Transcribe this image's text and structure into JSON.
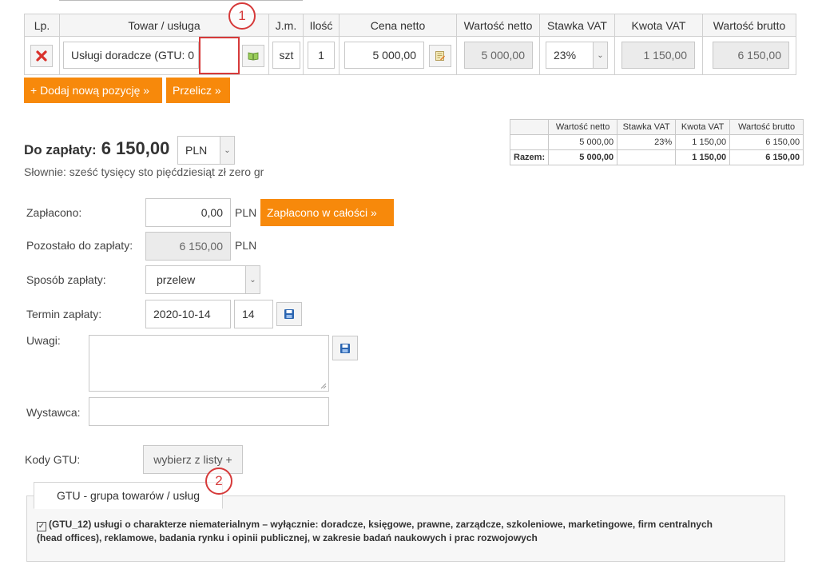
{
  "items_table": {
    "headers": [
      "Lp.",
      "Towar / usługa",
      "J.m.",
      "Ilość",
      "Cena netto",
      "Wartość netto",
      "Stawka VAT",
      "Kwota VAT",
      "Wartość brutto"
    ],
    "row": {
      "name": "Usługi doradcze (GTU: 0",
      "unit": "szt",
      "qty": "1",
      "price": "5 000,00",
      "net": "5 000,00",
      "vat_rate": "23%",
      "vat_amount": "1 150,00",
      "gross": "6 150,00"
    }
  },
  "buttons": {
    "add_position": "+ Dodaj nową pozycję »",
    "recalculate": "Przelicz »",
    "paid_full": "Zapłacono w całości »",
    "pick_list": "wybierz z listy +"
  },
  "due": {
    "label": "Do zapłaty:",
    "amount": "6 150,00",
    "currency": "PLN",
    "in_words": "Słownie: sześć tysięcy sto pięćdziesiąt zł zero gr"
  },
  "summary": {
    "headers": [
      "",
      "Wartość netto",
      "Stawka VAT",
      "Kwota VAT",
      "Wartość brutto"
    ],
    "row": [
      "",
      "5 000,00",
      "23%",
      "1 150,00",
      "6 150,00"
    ],
    "total": [
      "Razem:",
      "5 000,00",
      "",
      "1 150,00",
      "6 150,00"
    ]
  },
  "form": {
    "paid_label": "Zapłacono:",
    "paid_value": "0,00",
    "paid_currency": "PLN",
    "remaining_label": "Pozostało do zapłaty:",
    "remaining_value": "6 150,00",
    "remaining_currency": "PLN",
    "method_label": "Sposób zapłaty:",
    "method_value": "przelew",
    "deadline_label": "Termin zapłaty:",
    "deadline_date": "2020-10-14",
    "deadline_days": "14",
    "notes_label": "Uwagi:",
    "issuer_label": "Wystawca:",
    "gtu_label": "Kody GTU:"
  },
  "gtu": {
    "tab": "GTU - grupa towarów / usług",
    "item": "(GTU_12) usługi o charakterze niematerialnym – wyłącznie: doradcze, księgowe, prawne, zarządcze, szkoleniowe, marketingowe, firm centralnych (head offices), reklamowe, badania rynku i opinii publicznej, w zakresie badań naukowych i prac rozwojowych"
  },
  "callouts": [
    "1",
    "2"
  ],
  "colors": {
    "accent": "#f7890b",
    "callout": "#d63a3a"
  }
}
